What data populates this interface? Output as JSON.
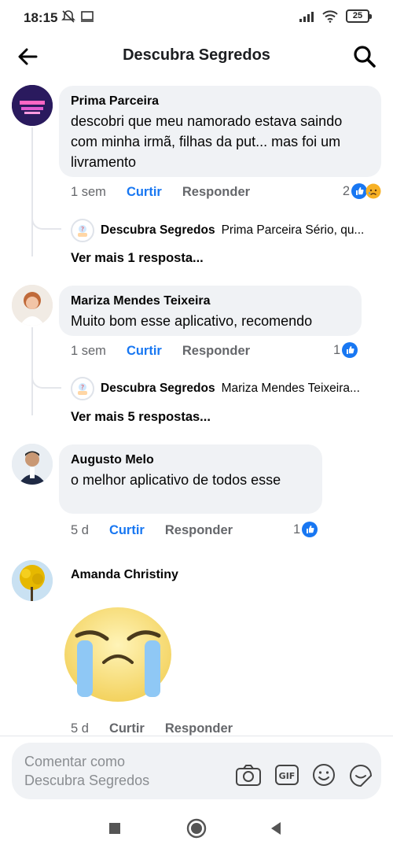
{
  "status": {
    "time": "18:15",
    "battery": "25"
  },
  "header": {
    "title": "Descubra Segredos"
  },
  "comments": [
    {
      "author": "Prima Parceira",
      "text": "descobri que meu namorado estava saindo com minha irmã, filhas da put... mas foi um livramento",
      "time": "1 sem",
      "like": "Curtir",
      "reply": "Responder",
      "reaction_count": "2",
      "reply_preview": {
        "author": "Descubra Segredos",
        "text": "Prima Parceira Sério, qu..."
      },
      "see_more": "Ver mais 1 resposta..."
    },
    {
      "author": "Mariza Mendes Teixeira",
      "text": "Muito bom esse aplicativo, recomendo",
      "time": "1 sem",
      "like": "Curtir",
      "reply": "Responder",
      "reaction_count": "1",
      "reply_preview": {
        "author": "Descubra Segredos",
        "text": "Mariza Mendes Teixeira..."
      },
      "see_more": "Ver mais 5 respostas..."
    },
    {
      "author": "Augusto Melo",
      "text": "o melhor aplicativo de todos esse",
      "time": "5 d",
      "like": "Curtir",
      "reply": "Responder",
      "reaction_count": "1"
    },
    {
      "author": "Amanda Christiny",
      "time": "5 d",
      "like": "Curtir",
      "reply": "Responder"
    }
  ],
  "composer": {
    "placeholder_line1": "Comentar como",
    "placeholder_line2": "Descubra Segredos"
  },
  "icons": {
    "back": "arrow-left-icon",
    "search": "search-icon",
    "camera": "camera-icon",
    "gif": "gif-icon",
    "emoji": "smiley-icon",
    "sticker": "sticker-icon",
    "like_reaction": "thumbs-up-icon",
    "sad_reaction": "sad-face-icon"
  },
  "colors": {
    "accent": "#1877f2",
    "bubble": "#f0f2f5",
    "meta": "#65676b"
  }
}
